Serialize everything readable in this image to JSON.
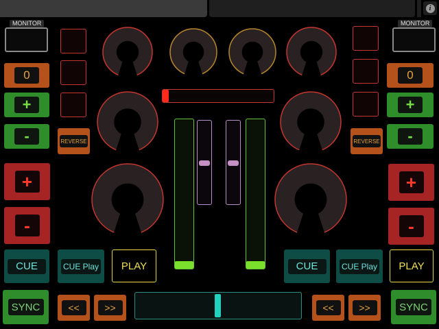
{
  "topbar": {
    "info_icon": "info-icon",
    "info_glyph": "i"
  },
  "left_deck": {
    "monitor_label": "MONITOR",
    "pitch_value": "0",
    "plus": "+",
    "minus": "-",
    "reverse": "REVERSE",
    "bend_plus": "+",
    "bend_minus": "-",
    "cue": "CUE",
    "cue_play": "CUE Play",
    "play": "PLAY",
    "sync": "SYNC",
    "rew": "<<",
    "ff": ">>"
  },
  "right_deck": {
    "monitor_label": "MONITOR",
    "pitch_value": "0",
    "plus": "+",
    "minus": "-",
    "reverse": "REVERSE",
    "bend_plus": "+",
    "bend_minus": "-",
    "cue": "CUE",
    "cue_play": "CUE Play",
    "play": "PLAY",
    "sync": "SYNC",
    "rew": "<<",
    "ff": ">>"
  },
  "mixer": {
    "pitch_position": 0.0,
    "left_volume": 0.4,
    "right_volume": 0.4,
    "left_meter": 0.05,
    "right_meter": 0.05,
    "crossfader": 0.5
  },
  "colors": {
    "red": "#c6362e",
    "orange": "#b5521c",
    "green": "#2f8d2b",
    "teal": "#0e4d46",
    "yellow": "#e7d93f",
    "knob_gold": "#b8862c"
  }
}
